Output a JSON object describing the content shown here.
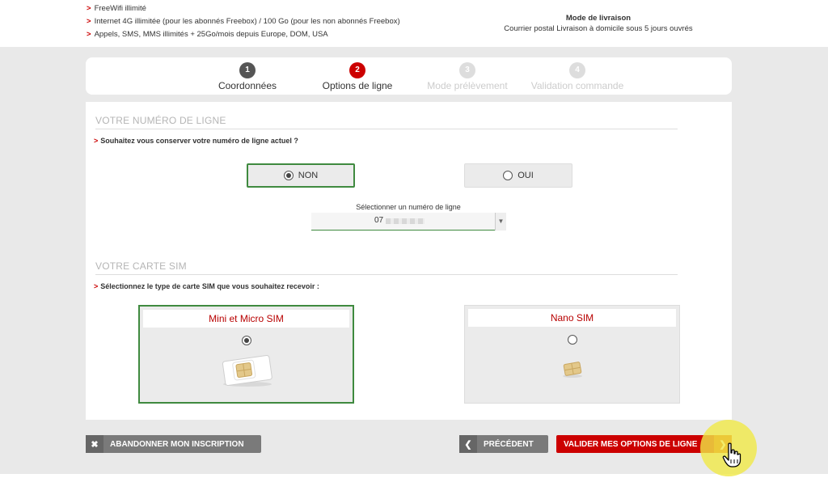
{
  "features": [
    "FreeWifi illimité",
    "Internet 4G illimitée (pour les abonnés Freebox) / 100 Go (pour les non abonnés Freebox)",
    "Appels, SMS, MMS illimités + 25Go/mois depuis Europe, DOM, USA"
  ],
  "delivery": {
    "title": "Mode de livraison",
    "text": "Courrier postal Livraison à domicile sous 5 jours ouvrés"
  },
  "steps": [
    {
      "num": "1",
      "label": "Coordonnées",
      "state": "done"
    },
    {
      "num": "2",
      "label": "Options de ligne",
      "state": "active"
    },
    {
      "num": "3",
      "label": "Mode prélèvement",
      "state": "todo"
    },
    {
      "num": "4",
      "label": "Validation commande",
      "state": "todo"
    }
  ],
  "line_section": {
    "title": "VOTRE NUMÉRO DE LIGNE",
    "question": "Souhaitez vous conserver votre numéro de ligne actuel ?",
    "option_no": "NON",
    "option_yes": "OUI",
    "selected": "NON",
    "select_label": "Sélectionner un numéro de ligne",
    "select_value": "07"
  },
  "sim_section": {
    "title": "VOTRE CARTE SIM",
    "question": "Sélectionnez le type de carte SIM que vous souhaitez recevoir :",
    "option_mini": "Mini et Micro SIM",
    "option_nano": "Nano SIM",
    "selected": "Mini et Micro SIM"
  },
  "buttons": {
    "abandon": "ABANDONNER MON INSCRIPTION",
    "prev": "PRÉCÉDENT",
    "validate": "VALIDER MES OPTIONS DE LIGNE"
  },
  "colors": {
    "brand_red": "#cc0000",
    "selected_green": "#3f8a3f",
    "neutral_button": "#7a7a7a"
  },
  "icons": {
    "abandon": "close-icon",
    "prev": "chevron-left-icon",
    "validate": "chevron-right-icon",
    "select": "chevron-down-icon",
    "cursor": "hand-pointer-icon"
  }
}
